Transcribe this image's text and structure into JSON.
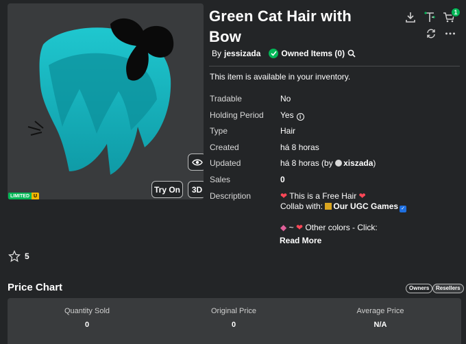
{
  "item": {
    "title_line1": "Green Cat Hair with",
    "title_line2": "Bow",
    "by_prefix": "By",
    "creator": "jessizada",
    "owned_label": "Owned Items (0)",
    "inventory_message": "This item is available in your inventory."
  },
  "thumbnail": {
    "badge_limited": "LIMITED",
    "badge_u": "U",
    "try_on_label": "Try On",
    "view_3d_label": "3D"
  },
  "header_icons": {
    "cart_count": "1"
  },
  "details": {
    "tradable": {
      "label": "Tradable",
      "value": "No"
    },
    "holding": {
      "label": "Holding Period",
      "value": "Yes"
    },
    "type": {
      "label": "Type",
      "value": "Hair"
    },
    "created": {
      "label": "Created",
      "value": "há 8 horas"
    },
    "updated": {
      "label": "Updated",
      "value_prefix": "há 8 horas (by",
      "user": "xiszada",
      "value_suffix": ")"
    },
    "sales": {
      "label": "Sales",
      "value": "0"
    },
    "description": {
      "label": "Description",
      "line1": "This is a Free Hair",
      "line2_prefix": "Collab with:",
      "line2_link": "Our UGC Games",
      "line3": "~",
      "line3_text": "Other colors - Click:",
      "read_more": "Read More"
    }
  },
  "favorites": {
    "count": "5"
  },
  "price_chart": {
    "title": "Price Chart",
    "owners_label": "Owners",
    "resellers_label": "Resellers",
    "stats": [
      {
        "label": "Quantity Sold",
        "value": "0"
      },
      {
        "label": "Original Price",
        "value": "0"
      },
      {
        "label": "Average Price",
        "value": "N/A"
      }
    ]
  },
  "colors": {
    "background": "#232527",
    "panel": "#393b3d",
    "hair_teal": "#1ab3bd",
    "success_green": "#02b757"
  }
}
